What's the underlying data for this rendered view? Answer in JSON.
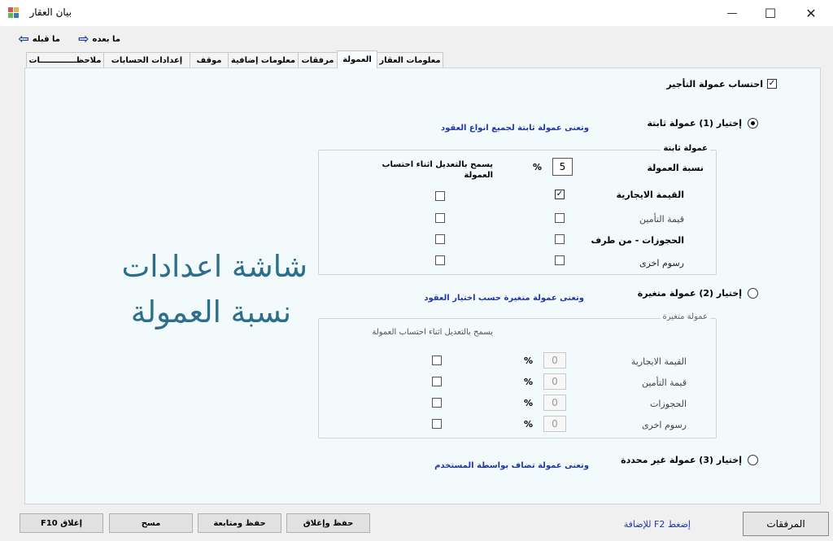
{
  "window": {
    "title": "بيان العقار",
    "minimize": "—",
    "maximize": "☐",
    "close": "✕"
  },
  "nav": {
    "prev_label": "ما قبله",
    "next_label": "ما بعده"
  },
  "tabs": [
    {
      "label": "معلومات العقار",
      "active": false
    },
    {
      "label": "العمولة",
      "active": true
    },
    {
      "label": "مرفقات",
      "active": false
    },
    {
      "label": "معلومات إضافية",
      "active": false
    },
    {
      "label": "موقف",
      "active": false
    },
    {
      "label": "إعدادات الحسابات",
      "active": false
    },
    {
      "label": "ملاحظـــــــــــــات",
      "active": false
    }
  ],
  "commission": {
    "enable_label": "احتساب عمولة التأجير",
    "enable_checked": true,
    "option1": {
      "label": "إختيار (1) عمولة  ثابتة",
      "hint": "وتعنى عمولة ثابتة لجميع انواع العقود",
      "selected": true
    },
    "fixed_group": {
      "title": "عمولة ثابتة",
      "rate_label": "نسبة العمولة",
      "rate_value": "5",
      "percent": "%",
      "allow_edit_header": "يسمح بالتعديل اثناء احتساب العمولة",
      "rows": [
        {
          "label": "القيمة الايجارية",
          "checked": true,
          "allow_edit": false
        },
        {
          "label": "قيمة التأمين",
          "checked": false,
          "allow_edit": false
        },
        {
          "label": "الحجوزات - من طرف",
          "checked": false,
          "allow_edit": false
        },
        {
          "label": "رسوم اخرى",
          "checked": false,
          "allow_edit": false
        }
      ]
    },
    "option2": {
      "label": "إختيار (2) عمولة متغيرة",
      "hint": "وتعنى عمولة متغيرة حسب اختيار العقود",
      "selected": false
    },
    "variable_group": {
      "title": "عمولة متغيرة",
      "allow_edit_header": "يسمح بالتعديل اثناء احتساب العمولة",
      "rows": [
        {
          "label": "القيمة الايجارية",
          "value": "0",
          "percent": "%",
          "allow_edit": false
        },
        {
          "label": "قيمة التأمين",
          "value": "0",
          "percent": "%",
          "allow_edit": false
        },
        {
          "label": "الحجوزات",
          "value": "0",
          "percent": "%",
          "allow_edit": false
        },
        {
          "label": "رسوم اخرى",
          "value": "0",
          "percent": "%",
          "allow_edit": false
        }
      ]
    },
    "option3": {
      "label": "إختيار (3) عمولة غير محددة",
      "hint": "وتعنى عمولة تضاف بواسطة المستخدم",
      "selected": false
    }
  },
  "overlay": {
    "line1": "شاشة اعدادات",
    "line2": "نسبة العمولة"
  },
  "footer": {
    "close_label": "إغلاق F10",
    "clear_label": "مسح",
    "save_continue_label": "حفظ ومتابعة",
    "save_close_label": "حفظ وإغلاق",
    "hint": "إضغط F2 للإضافة",
    "attachments_label": "المرفقات"
  }
}
